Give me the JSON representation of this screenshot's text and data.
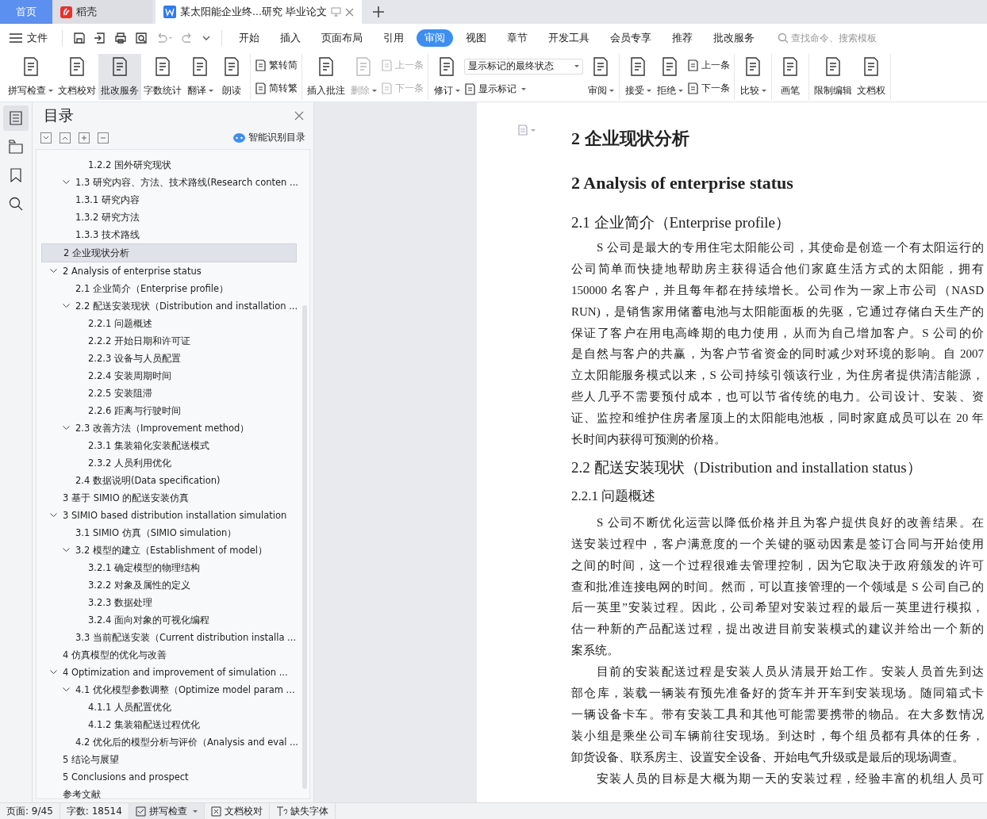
{
  "app_tabs": [
    {
      "label": "首页",
      "kind": "home",
      "selected": false
    },
    {
      "label": "稻壳",
      "kind": "brand",
      "selected": false
    },
    {
      "label": "某太阳能企业终...研究 毕业论文",
      "kind": "document",
      "selected": true
    }
  ],
  "menu": {
    "file_label": "文件",
    "tabs": [
      {
        "label": "开始",
        "selected": false
      },
      {
        "label": "插入",
        "selected": false
      },
      {
        "label": "页面布局",
        "selected": false
      },
      {
        "label": "引用",
        "selected": false
      },
      {
        "label": "审阅",
        "selected": true
      },
      {
        "label": "视图",
        "selected": false
      },
      {
        "label": "章节",
        "selected": false
      },
      {
        "label": "开发工具",
        "selected": false
      },
      {
        "label": "会员专享",
        "selected": false
      },
      {
        "label": "推荐",
        "selected": false
      },
      {
        "label": "批改服务",
        "selected": false
      }
    ],
    "search": {
      "placeholder": "查找命令、搜索模板"
    }
  },
  "ribbon": [
    {
      "items": [
        {
          "kind": "big",
          "label": "拼写检查",
          "caret": true,
          "selected": false,
          "disabled": false
        },
        {
          "kind": "big",
          "label": "文档校对",
          "caret": false,
          "selected": false,
          "disabled": false
        },
        {
          "kind": "big",
          "label": "批改服务",
          "caret": false,
          "selected": true,
          "disabled": false
        },
        {
          "kind": "big",
          "label": "字数统计",
          "caret": false,
          "selected": false,
          "disabled": false
        },
        {
          "kind": "big",
          "label": "翻译",
          "caret": true,
          "selected": false,
          "disabled": false
        },
        {
          "kind": "big",
          "label": "朗读",
          "caret": false,
          "selected": false,
          "disabled": false
        }
      ]
    },
    {
      "items": [
        {
          "kind": "stack",
          "items": [
            {
              "label": "繁转简",
              "caret": false,
              "disabled": false
            },
            {
              "label": "简转繁",
              "caret": false,
              "disabled": false
            }
          ]
        }
      ]
    },
    {
      "items": [
        {
          "kind": "big",
          "label": "插入批注",
          "caret": false,
          "selected": false,
          "disabled": false
        },
        {
          "kind": "big",
          "label": "删除",
          "caret": true,
          "selected": false,
          "disabled": true
        },
        {
          "kind": "stack",
          "items": [
            {
              "label": "上一条",
              "caret": false,
              "disabled": true
            },
            {
              "label": "下一条",
              "caret": false,
              "disabled": true
            }
          ]
        }
      ]
    },
    {
      "items": [
        {
          "kind": "big",
          "label": "修订",
          "caret": true,
          "selected": false,
          "disabled": false
        },
        {
          "kind": "dropdown",
          "value": "显示标记的最终状态",
          "label": "显示标记",
          "caret": true,
          "disabled": false
        },
        {
          "kind": "big",
          "label": "审阅",
          "caret": true,
          "selected": false,
          "disabled": false
        }
      ]
    },
    {
      "items": [
        {
          "kind": "big",
          "label": "接受",
          "caret": true,
          "selected": false,
          "disabled": false
        },
        {
          "kind": "big",
          "label": "拒绝",
          "caret": true,
          "selected": false,
          "disabled": false
        },
        {
          "kind": "stack",
          "items": [
            {
              "label": "上一条",
              "caret": false,
              "disabled": false
            },
            {
              "label": "下一条",
              "caret": false,
              "disabled": false
            }
          ]
        }
      ]
    },
    {
      "items": [
        {
          "kind": "big",
          "label": "比较",
          "caret": true,
          "selected": false,
          "disabled": false
        }
      ]
    },
    {
      "items": [
        {
          "kind": "big",
          "label": "画笔",
          "caret": false,
          "selected": false,
          "disabled": false
        }
      ]
    },
    {
      "items": [
        {
          "kind": "big",
          "label": "限制编辑",
          "caret": false,
          "selected": false,
          "disabled": false
        },
        {
          "kind": "big",
          "label": "文档权",
          "caret": false,
          "selected": false,
          "disabled": false
        }
      ]
    }
  ],
  "toc": {
    "title": "目录",
    "smart_label": "智能识别目录",
    "items": [
      {
        "kind": "subsection",
        "title": "1.2.2  国外研究现状",
        "selected": false
      },
      {
        "kind": "section",
        "title": "1.3  研究内容、方法、技术路线(Research conten ...",
        "expanded": true,
        "selected": false,
        "children": [
          {
            "title": "1.3.1  研究内容",
            "selected": false
          },
          {
            "title": "1.3.2  研究方法",
            "selected": false
          },
          {
            "title": "1.3.3  技术路线",
            "selected": false
          }
        ]
      },
      {
        "kind": "chapter",
        "title": "2  企业现状分析",
        "selected": true
      },
      {
        "kind": "chapter",
        "title": "2 Analysis of enterprise status",
        "expanded": true,
        "selected": false,
        "children": [
          {
            "title": "2.1  企业简介（Enterprise profile）",
            "selected": false
          },
          {
            "title": "2.2  配送安装现状（Distribution and installation ...",
            "expanded": true,
            "selected": false,
            "children": [
              {
                "title": "2.2.1  问题概述",
                "selected": false
              },
              {
                "title": "2.2.2  开始日期和许可证",
                "selected": false
              },
              {
                "title": "2.2.3  设备与人员配置",
                "selected": false
              },
              {
                "title": "2.2.4  安装周期时间",
                "selected": false
              },
              {
                "title": "2.2.5  安装阻滞",
                "selected": false
              },
              {
                "title": "2.2.6  距离与行驶时间",
                "selected": false
              }
            ]
          },
          {
            "title": "2.3  改善方法（Improvement method）",
            "expanded": true,
            "selected": false,
            "children": [
              {
                "title": "2.3.1  集装箱化安装配送模式",
                "selected": false
              },
              {
                "title": "2.3.2  人员利用优化",
                "selected": false
              }
            ]
          },
          {
            "title": "2.4  数据说明(Data specification)",
            "selected": false
          }
        ]
      },
      {
        "kind": "chapter",
        "title": "3  基于 SIMIO 的配送安装仿真",
        "selected": false
      },
      {
        "kind": "chapter",
        "title": "3 SIMIO based distribution installation simulation",
        "expanded": true,
        "selected": false,
        "children": [
          {
            "title": "3.1 SIMIO 仿真（SIMIO simulation）",
            "selected": false
          },
          {
            "title": "3.2  模型的建立（Establishment of model）",
            "expanded": true,
            "selected": false,
            "children": [
              {
                "title": "3.2.1  确定模型的物理结构",
                "selected": false
              },
              {
                "title": "3.2.2  对象及属性的定义",
                "selected": false
              },
              {
                "title": "3.2.3  数据处理",
                "selected": false
              },
              {
                "title": "3.2.4  面向对象的可视化编程",
                "selected": false
              }
            ]
          },
          {
            "title": "3.3  当前配送安装（Current distribution installa ...",
            "selected": false
          }
        ]
      },
      {
        "kind": "chapter",
        "title": "4  仿真模型的优化与改善",
        "selected": false
      },
      {
        "kind": "chapter",
        "title": "4 Optimization and improvement of simulation  ...",
        "expanded": true,
        "selected": false,
        "children": [
          {
            "title": "4.1  优化模型参数调整（Optimize model param ...",
            "expanded": true,
            "selected": false,
            "children": [
              {
                "title": "4.1.1  人员配置优化",
                "selected": false
              },
              {
                "title": "4.1.2  集装箱配送过程优化",
                "selected": false
              }
            ]
          },
          {
            "title": "4.2  优化后的模型分析与评价（Analysis and eval ...",
            "selected": false
          }
        ]
      },
      {
        "kind": "chapter",
        "title": "5  结论与展望",
        "selected": false
      },
      {
        "kind": "chapter",
        "title": "5 Conclusions and prospect",
        "selected": false
      },
      {
        "kind": "chapter",
        "title": "参考文献",
        "selected": false
      }
    ]
  },
  "document": [
    {
      "kind": "h1",
      "text": "2  企业现状分析"
    },
    {
      "kind": "h1",
      "text": "2 Analysis of enterprise status"
    },
    {
      "kind": "h2",
      "text": "2.1  企业简介（Enterprise profile）"
    },
    {
      "kind": "paragraph",
      "lines": [
        "S 公司是最大的专用住宅太阳能公司，其使命是创造一个有太阳运行的",
        "公司简单而快捷地帮助房主获得适合他们家庭生活方式的太阳能，拥有",
        "150000 名客户，并且每年都在持续增长。公司作为一家上市公司（NASD",
        "RUN)，是销售家用储蓄电池与太阳能面板的先驱，它通过存储白天生产的",
        "保证了客户在用电高峰期的电力使用，从而为自己增加客户。S 公司的价",
        "是自然与客户的共赢，为客户节省资金的同时减少对环境的影响。自 2007",
        "立太阳能服务模式以来，S 公司持续引领该行业，为住房者提供清洁能源，",
        "些人几乎不需要预付成本，也可以节省传统的电力。公司设计、安装、资",
        "证、监控和维护住房者屋顶上的太阳能电池板，同时家庭成员可以在 20 年",
        "长时间内获得可预测的价格。"
      ]
    },
    {
      "kind": "h2",
      "text": "2.2  配送安装现状（Distribution and installation status）"
    },
    {
      "kind": "h3",
      "text": "2.2.1  问题概述"
    },
    {
      "kind": "paragraph",
      "lines": [
        "S 公司不断优化运营以降低价格并且为客户提供良好的改善结果。在",
        "送安装过程中，客户满意度的一个关键的驱动因素是签订合同与开始使用",
        "之间的时间，这一个过程很难去管理控制，因为它取决于政府颁发的许可",
        "查和批准连接电网的时间。然而，可以直接管理的一个领域是 S 公司自己的",
        "后一英里”安装过程。因此，公司希望对安装过程的最后一英里进行模拟，",
        "估一种新的产品配送过程，提出改进目前安装模式的建议并给出一个新的",
        "案系统。"
      ]
    },
    {
      "kind": "paragraph",
      "lines": [
        "目前的安装配送过程是安装人员从清晨开始工作。安装人员首先到达",
        "部仓库，装载一辆装有预先准备好的货车并开车到安装现场。随同箱式卡",
        "一辆设备卡车。带有安装工具和其他可能需要携带的物品。在大多数情况",
        "装小组是乘坐公司车辆前往安现场。到达时，每个组员都有具体的任务，",
        "卸货设备、联系房主、设置安全设备、开始电气升级或是最后的现场调查。"
      ]
    },
    {
      "kind": "paragraph",
      "lines": [
        "安装人员的目标是大概为期一天的安装过程，经验丰富的机组人员可"
      ]
    }
  ],
  "status_bar": [
    {
      "kind": "text",
      "label": "页面: 9/45"
    },
    {
      "kind": "text",
      "label": "字数: 18514"
    },
    {
      "kind": "check",
      "label": "拼写检查"
    },
    {
      "kind": "proof",
      "label": "文档校对"
    },
    {
      "kind": "font",
      "label": "缺失字体"
    }
  ]
}
